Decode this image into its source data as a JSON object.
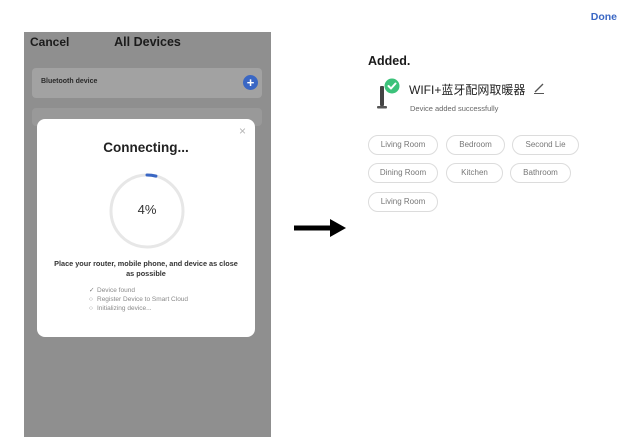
{
  "left_screen": {
    "cancel_label": "Cancel",
    "title": "All Devices",
    "bluetooth_label": "Bluetooth device",
    "add_symbol": "+",
    "modal": {
      "close_symbol": "×",
      "title": "Connecting...",
      "progress_text": "4%",
      "progress_value": 0.04,
      "hint": "Place your router, mobile phone, and device as close as possible",
      "steps": [
        {
          "mark": "✓",
          "label": "Device found"
        },
        {
          "mark": "○",
          "label": "Register Device to Smart Cloud"
        },
        {
          "mark": "○",
          "label": "Initializing device..."
        }
      ]
    }
  },
  "right_screen": {
    "done_label": "Done",
    "added_title": "Added.",
    "device_name": "WIFI+蓝牙配网取暖器",
    "device_status": "Device added successfully",
    "rooms": [
      "Living Room",
      "Bedroom",
      "Second Lie",
      "Dining Room",
      "Kitchen",
      "Bathroom",
      "Living Room"
    ]
  },
  "colors": {
    "accent_blue": "#3a67c4",
    "success_green": "#3cc27a",
    "overlay_gray": "#8f8f8f"
  },
  "icons": {
    "arrow": "right-arrow-icon",
    "check": "check-circle-icon",
    "edit": "pencil-icon",
    "device": "heater-icon"
  }
}
